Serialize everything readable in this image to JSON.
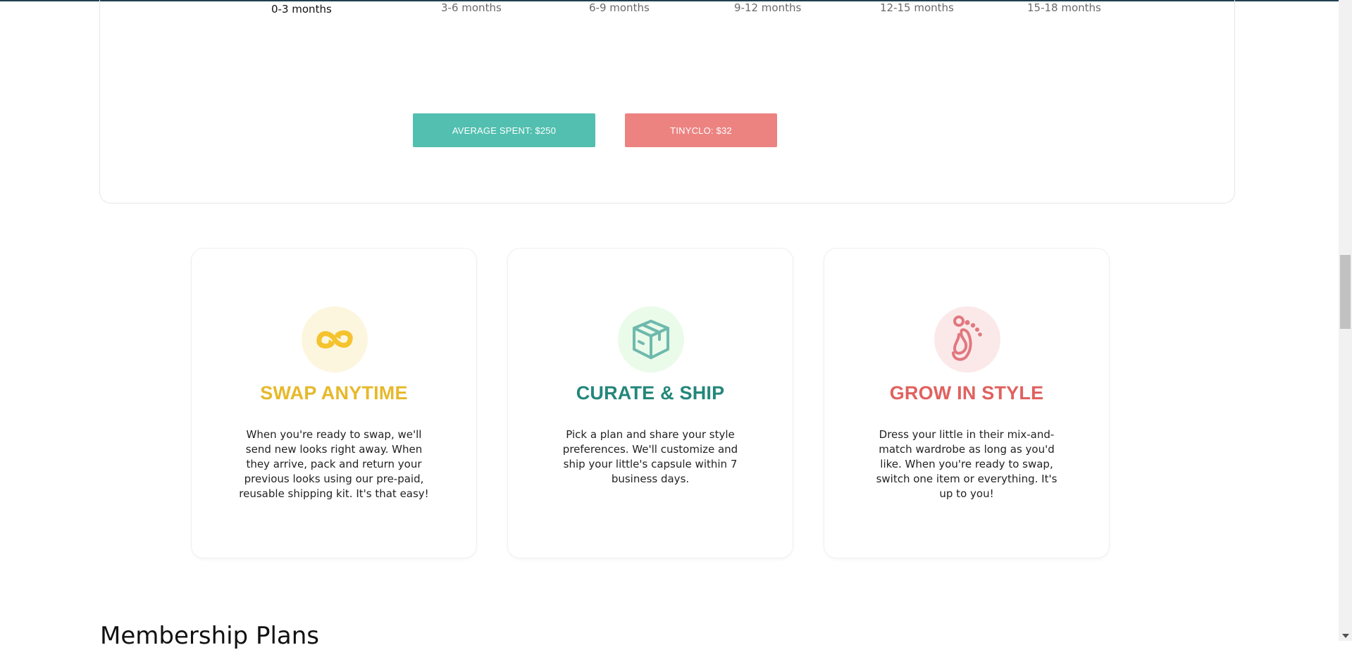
{
  "age_ranges": [
    "0-3 months",
    "3-6 months",
    "6-9 months",
    "9-12 months",
    "12-15 months",
    "15-18 months"
  ],
  "price_buttons": {
    "average": "AVERAGE SPENT: $250",
    "tinyclo": "TINYCLO: $32"
  },
  "features": [
    {
      "icon": "swap-arrows-icon",
      "title": "SWAP ANYTIME",
      "color": "#e6b92b",
      "circle_color": "#fdf6df",
      "description": "When you're ready to swap, we'll send new looks right away. When they arrive, pack and return your previous looks using our pre-paid, reusable shipping kit. It's that easy!"
    },
    {
      "icon": "box-icon",
      "title": "CURATE & SHIP",
      "color": "#23877a",
      "circle_color": "#eafbea",
      "description": "Pick a plan and share your style preferences. We'll customize and ship your little's capsule within 7 business days."
    },
    {
      "icon": "footprint-icon",
      "title": "GROW IN STYLE",
      "color": "#e0615f",
      "circle_color": "#fbe9ea",
      "description": "Dress your little in their mix-and-match wardrobe as long as you'd like. When you're ready to swap, switch one item or everything. It's up to you!"
    }
  ],
  "membership": {
    "title": "Membership Plans"
  }
}
